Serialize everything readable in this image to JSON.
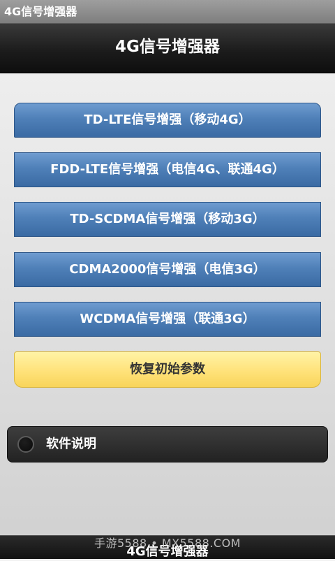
{
  "status_bar": {
    "title": "4G信号增强器"
  },
  "header": {
    "title": "4G信号增强器"
  },
  "buttons": [
    {
      "label": "TD-LTE信号增强（移动4G）"
    },
    {
      "label": "FDD-LTE信号增强（电信4G、联通4G）"
    },
    {
      "label": "TD-SCDMA信号增强（移动3G）"
    },
    {
      "label": "CDMA2000信号增强（电信3G）"
    },
    {
      "label": "WCDMA信号增强（联通3G）"
    }
  ],
  "reset_button": {
    "label": "恢复初始参数"
  },
  "help_item": {
    "label": "软件说明",
    "icon": "radio-icon"
  },
  "footer": {
    "title": "4G信号增强器"
  },
  "watermark": {
    "text": "手游5588 • MX5588.COM"
  },
  "colors": {
    "button_blue": "#4f80b8",
    "button_yellow": "#ffe27a",
    "header_dark": "#1c1c1c"
  }
}
